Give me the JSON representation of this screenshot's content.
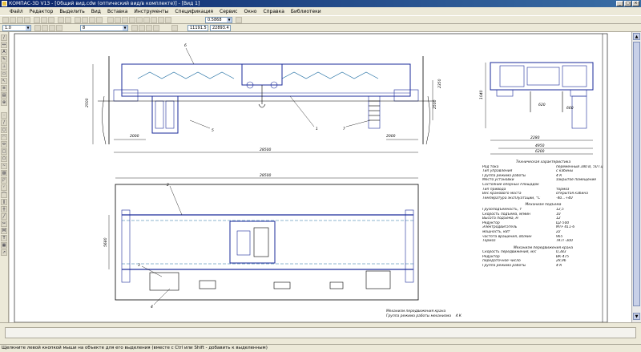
{
  "window": {
    "title": "КОМПАС-3D V13 - [Общий вид.cdw (оптический вид/в комплекте)] - [Вид 1]"
  },
  "menu": {
    "items": [
      "Файл",
      "Редактор",
      "Выделить",
      "Вид",
      "Вставка",
      "Инструменты",
      "Спецификация",
      "Сервис",
      "Окно",
      "Справка",
      "Библиотеки"
    ]
  },
  "toolbar": {
    "scale_value": "0.5868",
    "layer_value": "1.0",
    "style_value": "8",
    "coord_x": "11191.5",
    "coord_y": "22893.4"
  },
  "drawing": {
    "dims_top": [
      "2000",
      "2000",
      "28500",
      "2500",
      "2500",
      "2350"
    ],
    "dims_plan": [
      "28500",
      "5680"
    ],
    "dims_side": [
      "4950",
      "6200",
      "2280",
      "1040",
      "620",
      "660"
    ],
    "leaders": [
      "6",
      "5",
      "1",
      "7",
      "2",
      "3",
      "4"
    ],
    "spec_title": "Техническая характеристика",
    "spec_rows": [
      {
        "k": "Род тока",
        "v": "переменный 380 В, 50 Гц"
      },
      {
        "k": "Тип управления",
        "v": "с кабины"
      },
      {
        "k": "Группа режима работы",
        "v": "4 К"
      },
      {
        "k": "Место установки",
        "v": "закрытое помещение"
      },
      {
        "k": "Состояние опорных площадок",
        "v": ""
      },
      {
        "k": "Тип привода",
        "v": "тормоз"
      },
      {
        "k": "Вес кранового моста",
        "v": "открытая кабина"
      },
      {
        "k": "Температура эксплуатации, °С",
        "v": "-40...+40"
      }
    ],
    "spec_hoist_title": "Механизм подъема",
    "spec_hoist_rows": [
      {
        "k": "Грузоподъемность, т",
        "v": "12,5"
      },
      {
        "k": "Скорость подъема, м/мин",
        "v": "10"
      },
      {
        "k": "Высота подъема, м",
        "v": "12"
      },
      {
        "k": "Редуктор",
        "v": "Ц2-500"
      },
      {
        "k": "Электродвигатель",
        "v": "МТF 411-6"
      },
      {
        "k": "мощность, кВт",
        "v": "22"
      },
      {
        "k": "частота вращения, об/мин",
        "v": "965"
      },
      {
        "k": "Тормоз",
        "v": "ТКТГ-300"
      }
    ],
    "spec_bridge_title": "Механизм передвижения крана",
    "spec_bridge_rows": [
      {
        "k": "Скорость передвижения, м/с",
        "v": "0,383"
      },
      {
        "k": "Редуктор",
        "v": "ВК-475"
      },
      {
        "k": "передаточное число",
        "v": "29,96"
      },
      {
        "k": "Группа режима работы",
        "v": "4 К"
      }
    ],
    "bottom_note_1": "Механизм передвижения крана",
    "bottom_note_2": "Группа режима работы механизма",
    "bottom_note_value": "4 К"
  },
  "status": {
    "text": "Щелкните левой кнопкой мыши на объекте для его выделения (вместе с Ctrl или Shift - добавить к выделенным)"
  }
}
